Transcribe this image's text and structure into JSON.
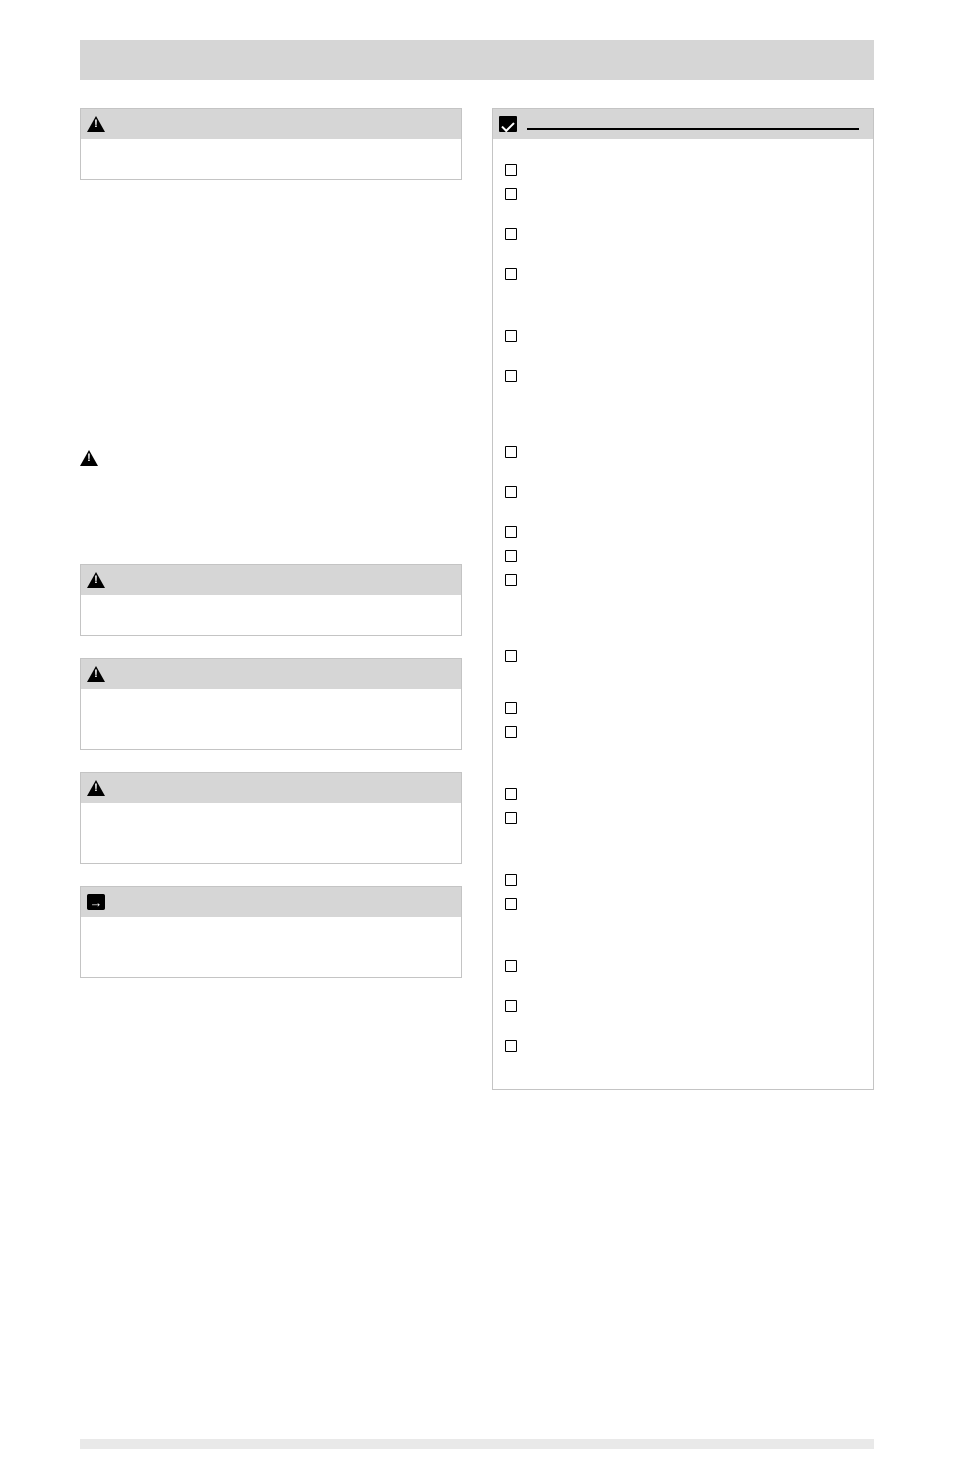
{
  "section": {
    "title": ""
  },
  "left": {
    "callouts": [
      {
        "kind": "warning",
        "title": "",
        "body": "",
        "body_h": "h"
      },
      {
        "kind": "plain",
        "title": "",
        "body": ""
      },
      {
        "kind": "warning",
        "title": "",
        "body": "",
        "body_h": "h"
      },
      {
        "kind": "warning",
        "title": "",
        "body": "",
        "body_h": "h44"
      },
      {
        "kind": "warning",
        "title": "",
        "body": "",
        "body_h": "h44"
      },
      {
        "kind": "notice",
        "title": "",
        "body": "",
        "body_h": "h44"
      }
    ]
  },
  "right": {
    "title": "",
    "groups": [
      {
        "header": "",
        "items": [
          {
            "text": "",
            "h": ""
          },
          {
            "text": "",
            "h": "h32"
          },
          {
            "text": "",
            "h": "h32"
          },
          {
            "text": "",
            "h": "h44"
          }
        ]
      },
      {
        "header": "",
        "items": [
          {
            "text": "",
            "h": "h32"
          },
          {
            "text": "",
            "h": "h58"
          }
        ]
      },
      {
        "header": "",
        "items": [
          {
            "text": "",
            "h": "h32"
          },
          {
            "text": "",
            "h": "h32"
          },
          {
            "text": "",
            "h": ""
          },
          {
            "text": "",
            "h": ""
          },
          {
            "text": "",
            "h": "h58"
          }
        ]
      },
      {
        "header": "",
        "items": [
          {
            "text": "",
            "h": "h44"
          },
          {
            "text": "",
            "h": ""
          },
          {
            "text": "",
            "h": "h44"
          }
        ]
      },
      {
        "header": "",
        "items": [
          {
            "text": "",
            "h": ""
          },
          {
            "text": "",
            "h": "h44"
          }
        ]
      },
      {
        "header": "",
        "items": [
          {
            "text": "",
            "h": ""
          },
          {
            "text": "",
            "h": "h44"
          }
        ]
      },
      {
        "header": "",
        "items": [
          {
            "text": "",
            "h": "h32"
          },
          {
            "text": "",
            "h": "h32"
          },
          {
            "text": "",
            "h": ""
          }
        ]
      }
    ]
  }
}
